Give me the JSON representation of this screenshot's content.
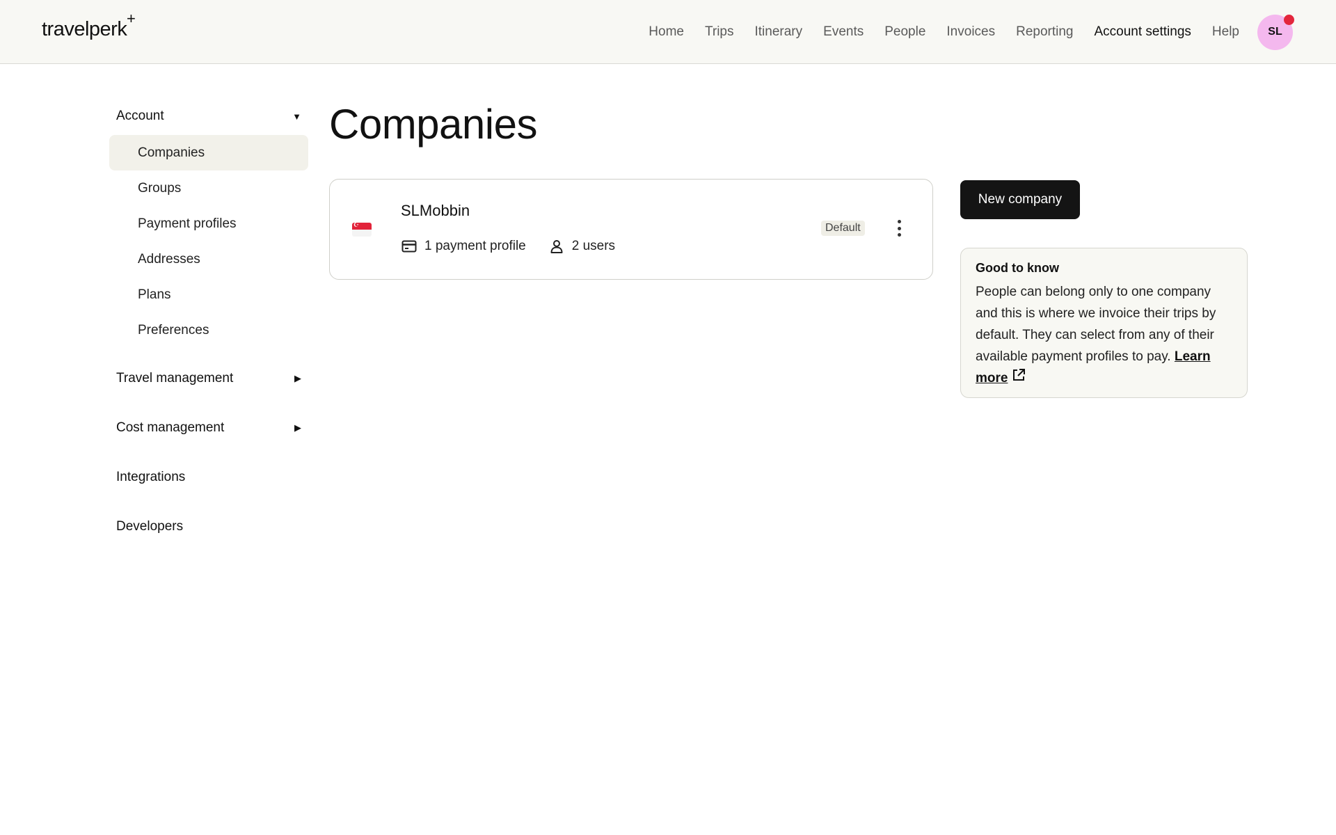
{
  "header": {
    "logo": "travelperk",
    "logo_plus": "+",
    "nav": [
      "Home",
      "Trips",
      "Itinerary",
      "Events",
      "People",
      "Invoices",
      "Reporting",
      "Account settings",
      "Help"
    ],
    "active_nav": "Account settings",
    "avatar_initials": "SL"
  },
  "sidebar": {
    "account": {
      "label": "Account",
      "items": [
        "Companies",
        "Groups",
        "Payment profiles",
        "Addresses",
        "Plans",
        "Preferences"
      ],
      "active": "Companies"
    },
    "travel_management": "Travel management",
    "cost_management": "Cost management",
    "integrations": "Integrations",
    "developers": "Developers"
  },
  "main": {
    "title": "Companies",
    "company": {
      "name": "SLMobbin",
      "country_flag": "singapore-flag-icon",
      "payment_profiles": "1 payment profile",
      "users": "2 users",
      "badge": "Default"
    },
    "new_company_button": "New company",
    "info": {
      "title": "Good to know",
      "text": "People can belong only to one company and this is where we invoice their trips by default. They can select from any of their available payment profiles to pay.",
      "link": "Learn more"
    }
  },
  "colors": {
    "header_bg": "#f8f8f4",
    "avatar_bg": "#f4b8ee",
    "notification_dot": "#e3263c",
    "button_bg": "#141414",
    "active_item_bg": "#f2f1ea"
  }
}
